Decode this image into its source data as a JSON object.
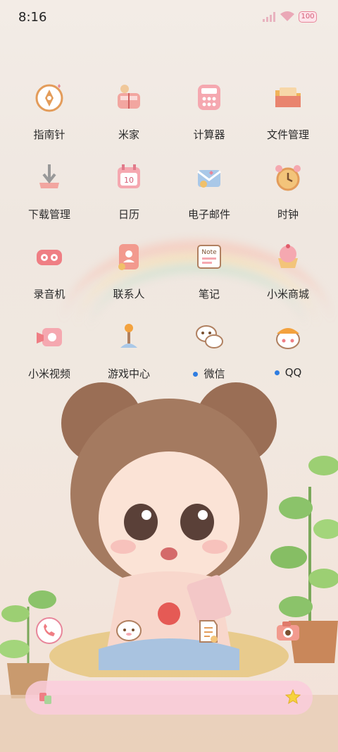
{
  "status_bar": {
    "time": "8:16",
    "battery": "100"
  },
  "apps": [
    {
      "label": "指南针",
      "icon": "compass-icon"
    },
    {
      "label": "米家",
      "icon": "mijia-icon"
    },
    {
      "label": "计算器",
      "icon": "calculator-icon"
    },
    {
      "label": "文件管理",
      "icon": "folder-icon"
    },
    {
      "label": "下载管理",
      "icon": "download-icon"
    },
    {
      "label": "日历",
      "icon": "calendar-icon",
      "badge_text": "10"
    },
    {
      "label": "电子邮件",
      "icon": "mail-icon"
    },
    {
      "label": "时钟",
      "icon": "alarm-clock-icon"
    },
    {
      "label": "录音机",
      "icon": "recorder-icon"
    },
    {
      "label": "联系人",
      "icon": "contacts-icon"
    },
    {
      "label": "笔记",
      "icon": "note-icon",
      "badge_text": "Note"
    },
    {
      "label": "小米商城",
      "icon": "cupcake-store-icon"
    },
    {
      "label": "小米视频",
      "icon": "video-icon"
    },
    {
      "label": "游戏中心",
      "icon": "joystick-icon"
    },
    {
      "label": "微信",
      "icon": "wechat-icon",
      "new_dot": true
    },
    {
      "label": "QQ",
      "icon": "qq-icon",
      "new_dot": true
    }
  ],
  "dock": [
    {
      "icon": "phone-icon"
    },
    {
      "icon": "messages-icon"
    },
    {
      "icon": "browser-icon"
    },
    {
      "icon": "camera-icon"
    }
  ],
  "colors": {
    "accent_pink": "#e8869a",
    "dot_blue": "#2f7de1",
    "icon_orange": "#e39c5a"
  }
}
